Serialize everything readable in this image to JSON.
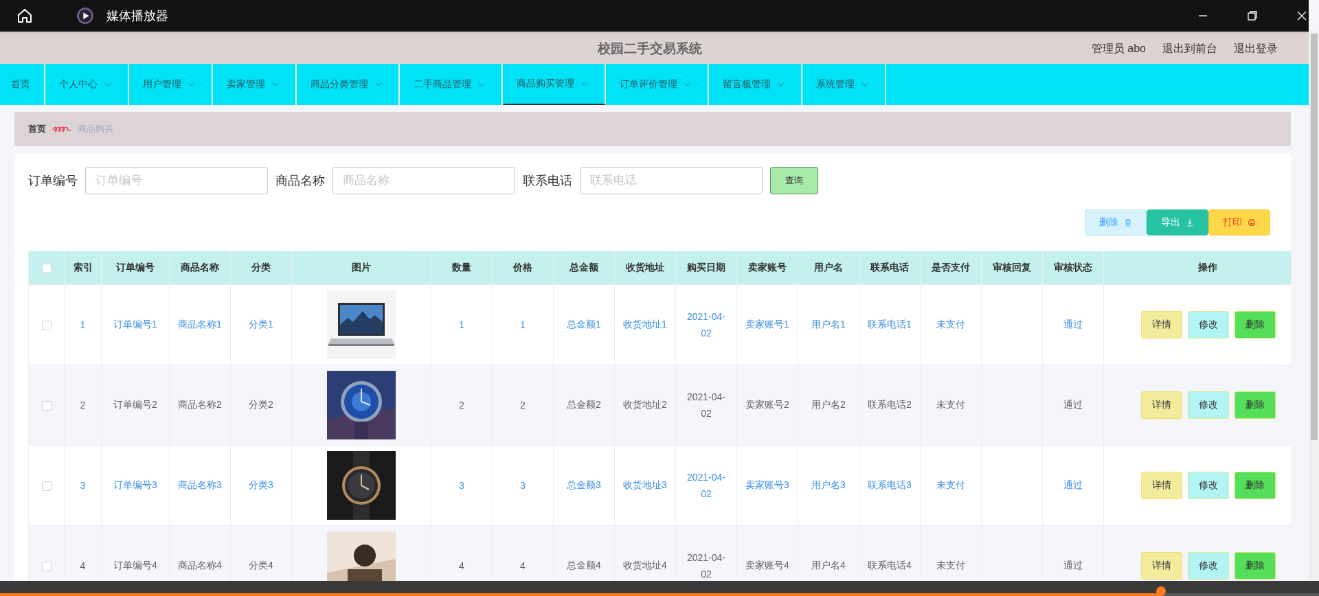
{
  "window": {
    "title": "媒体播放器"
  },
  "header": {
    "title": "校园二手交易系统",
    "user": "管理员 abo",
    "links": [
      "退出到前台",
      "退出登录"
    ]
  },
  "nav": [
    {
      "label": "首页",
      "dropdown": false,
      "selected": false
    },
    {
      "label": "个人中心",
      "dropdown": true,
      "selected": false
    },
    {
      "label": "用户管理",
      "dropdown": true,
      "selected": false
    },
    {
      "label": "卖家管理",
      "dropdown": true,
      "selected": false
    },
    {
      "label": "商品分类管理",
      "dropdown": true,
      "selected": false
    },
    {
      "label": "二手商品管理",
      "dropdown": true,
      "selected": false
    },
    {
      "label": "商品购买管理",
      "dropdown": true,
      "selected": true
    },
    {
      "label": "订单评价管理",
      "dropdown": true,
      "selected": false
    },
    {
      "label": "留言板管理",
      "dropdown": true,
      "selected": false
    },
    {
      "label": "系统管理",
      "dropdown": true,
      "selected": false
    }
  ],
  "breadcrumb": [
    "首页",
    "商品购买"
  ],
  "search": {
    "fields": [
      {
        "label": "订单编号",
        "placeholder": "订单编号"
      },
      {
        "label": "商品名称",
        "placeholder": "商品名称"
      },
      {
        "label": "联系电话",
        "placeholder": "联系电话"
      }
    ],
    "button": "查询"
  },
  "toolbar": [
    {
      "label": "删除",
      "kind": "delete"
    },
    {
      "label": "导出",
      "kind": "export"
    },
    {
      "label": "打印",
      "kind": "print"
    }
  ],
  "table": {
    "select_all": {
      "checked": false
    },
    "columns": [
      {
        "label": "索引",
        "kind": "text"
      },
      {
        "label": "订单编号",
        "kind": "text"
      },
      {
        "label": "商品名称",
        "kind": "text"
      },
      {
        "label": "分类",
        "kind": "text"
      },
      {
        "label": "图片",
        "kind": "picture"
      },
      {
        "label": "数量",
        "kind": "text"
      },
      {
        "label": "价格",
        "kind": "text"
      },
      {
        "label": "总金额",
        "kind": "text"
      },
      {
        "label": "收货地址",
        "kind": "text"
      },
      {
        "label": "购买日期",
        "kind": "date"
      },
      {
        "label": "卖家账号",
        "kind": "text"
      },
      {
        "label": "用户名",
        "kind": "text"
      },
      {
        "label": "联系电话",
        "kind": "text"
      },
      {
        "label": "是否支付",
        "kind": "text"
      },
      {
        "label": "审核回复",
        "kind": "text"
      },
      {
        "label": "审核状态",
        "kind": "text"
      },
      {
        "label": "操作",
        "kind": "actions"
      }
    ],
    "rows": [
      {
        "checked": false,
        "cells": [
          "1",
          "订单编号1",
          "商品名称1",
          "分类1",
          {
            "kind": "picture"
          },
          "1",
          "1",
          "总金额1",
          "收货地址1",
          "2021-04-02",
          "卖家账号1",
          "用户名1",
          "联系电话1",
          "未支付",
          "",
          "通过"
        ],
        "actions": [
          "详情",
          "修改",
          "删除"
        ]
      },
      {
        "checked": false,
        "cells": [
          "2",
          "订单编号2",
          "商品名称2",
          "分类2",
          {
            "kind": "picture"
          },
          "2",
          "2",
          "总金额2",
          "收货地址2",
          "2021-04-02",
          "卖家账号2",
          "用户名2",
          "联系电话2",
          "未支付",
          "",
          "通过"
        ],
        "actions": [
          "详情",
          "修改",
          "删除"
        ]
      },
      {
        "checked": false,
        "cells": [
          "3",
          "订单编号3",
          "商品名称3",
          "分类3",
          {
            "kind": "picture"
          },
          "3",
          "3",
          "总金额3",
          "收货地址3",
          "2021-04-02",
          "卖家账号3",
          "用户名3",
          "联系电话3",
          "未支付",
          "",
          "通过"
        ],
        "actions": [
          "详情",
          "修改",
          "删除"
        ]
      },
      {
        "checked": false,
        "cells": [
          "4",
          "订单编号4",
          "商品名称4",
          "分类4",
          {
            "kind": "picture"
          },
          "4",
          "4",
          "总金额4",
          "收货地址4",
          "2021-04-02",
          "卖家账号4",
          "用户名4",
          "联系电话4",
          "未支付",
          "",
          "通过"
        ],
        "actions": [
          "详情",
          "修改",
          "删除"
        ]
      }
    ]
  },
  "player": {
    "level": 0.88
  }
}
